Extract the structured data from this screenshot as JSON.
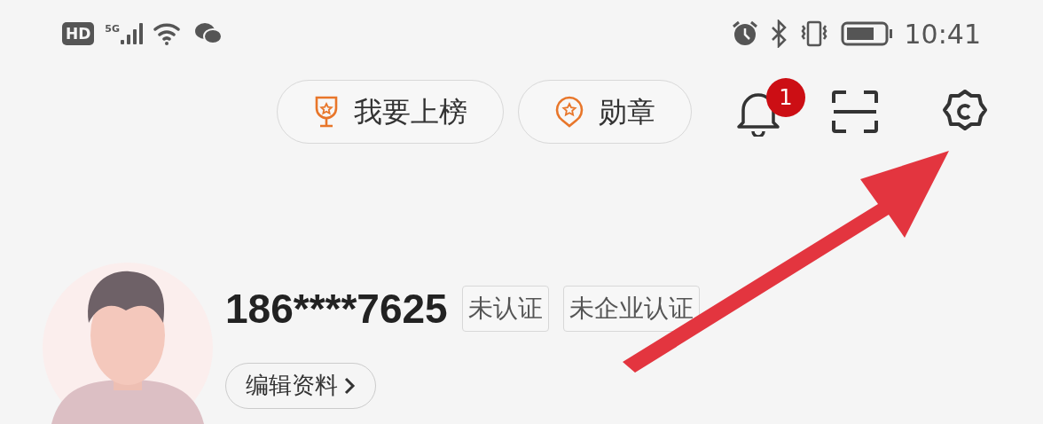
{
  "status_bar": {
    "hd": "HD",
    "network": "5G",
    "time": "10:41"
  },
  "toolbar": {
    "buttons": [
      {
        "label": "我要上榜",
        "kind": "trophy"
      },
      {
        "label": "勋章",
        "kind": "medal"
      }
    ],
    "notification_badge": "1"
  },
  "profile": {
    "phone": "186****7625",
    "tags": [
      "未认证",
      "未企业认证"
    ],
    "edit_button": "编辑资料"
  }
}
